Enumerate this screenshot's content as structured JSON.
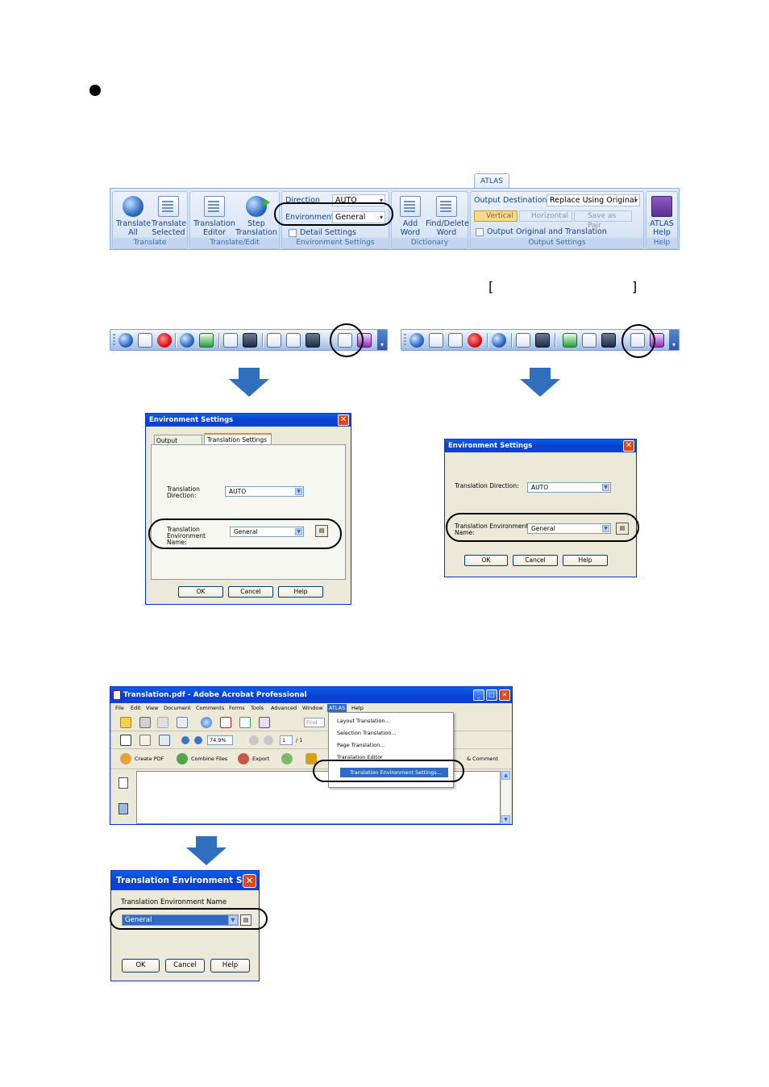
{
  "ribbon": {
    "tab_label": "ATLAS",
    "groups": {
      "translate": {
        "label": "Translate",
        "buttons": [
          {
            "line1": "Translate",
            "line2": "All"
          },
          {
            "line1": "Translate",
            "line2": "Selected"
          }
        ]
      },
      "translate_edit": {
        "label": "Translate/Edit",
        "buttons": [
          {
            "line1": "Translation",
            "line2": "Editor"
          },
          {
            "line1": "Step",
            "line2": "Translation"
          }
        ]
      },
      "environment_settings": {
        "label": "Environment Settings",
        "direction_label": "Direction",
        "direction_value": "AUTO",
        "environment_label": "Environment",
        "environment_value": "General",
        "detail_settings": "Detail Settings"
      },
      "dictionary": {
        "label": "Dictionary",
        "buttons": [
          {
            "line1": "Add",
            "line2": "Word"
          },
          {
            "line1": "Find/Delete",
            "line2": "Word"
          }
        ]
      },
      "output_settings": {
        "label": "Output Settings",
        "destination_label": "Output Destination",
        "destination_value": "Replace Using Original",
        "vertical": "Vertical",
        "horizontal": "Horizontal",
        "save_as_pair": "Save as Pair",
        "output_original": "Output Original and Translation"
      },
      "help": {
        "label": "Help",
        "button_line1": "ATLAS",
        "button_line2": "Help"
      }
    }
  },
  "brackets": {
    "open": "[",
    "close": "]"
  },
  "dialog_left": {
    "title": "Environment Settings",
    "tabs": [
      "Output Settings",
      "Translation Settings"
    ],
    "direction_label_1": "Translation",
    "direction_label_2": "Direction:",
    "direction_value": "AUTO",
    "env_label_1": "Translation",
    "env_label_2": "Environment",
    "env_label_3": "Name:",
    "env_value": "General",
    "ok": "OK",
    "cancel": "Cancel",
    "help": "Help"
  },
  "dialog_right": {
    "title": "Environment Settings",
    "direction_label": "Translation Direction:",
    "direction_value": "AUTO",
    "env_label_1": "Translation Environment",
    "env_label_2": "Name:",
    "env_value": "General",
    "ok": "OK",
    "cancel": "Cancel",
    "help": "Help"
  },
  "acrobat": {
    "title": "Translation.pdf - Adobe Acrobat Professional",
    "menus": [
      "File",
      "Edit",
      "View",
      "Document",
      "Comments",
      "Forms",
      "Tools",
      "Advanced",
      "Window",
      "ATLAS",
      "Help"
    ],
    "find_placeholder": "Find",
    "zoom": "74.9%",
    "page_current": "1",
    "page_total": "/ 1",
    "tasks": {
      "create_pdf": "Create PDF",
      "combine_files": "Combine Files",
      "export": "Export",
      "review_comment": "& Comment"
    },
    "atlas_menu": [
      "Layout Translation...",
      "Selection Translation...",
      "Page Translation...",
      "Translation Editor",
      "Translation Environment Settings..."
    ]
  },
  "dialog_bottom": {
    "title": "Translation Environment S...",
    "label": "Translation Environment Name",
    "value": "General",
    "ok": "OK",
    "cancel": "Cancel",
    "help": "Help"
  },
  "colors": {
    "arrow": "#2f6fbe",
    "xp_title": "#0b3fcf",
    "selection": "#316ac5"
  }
}
